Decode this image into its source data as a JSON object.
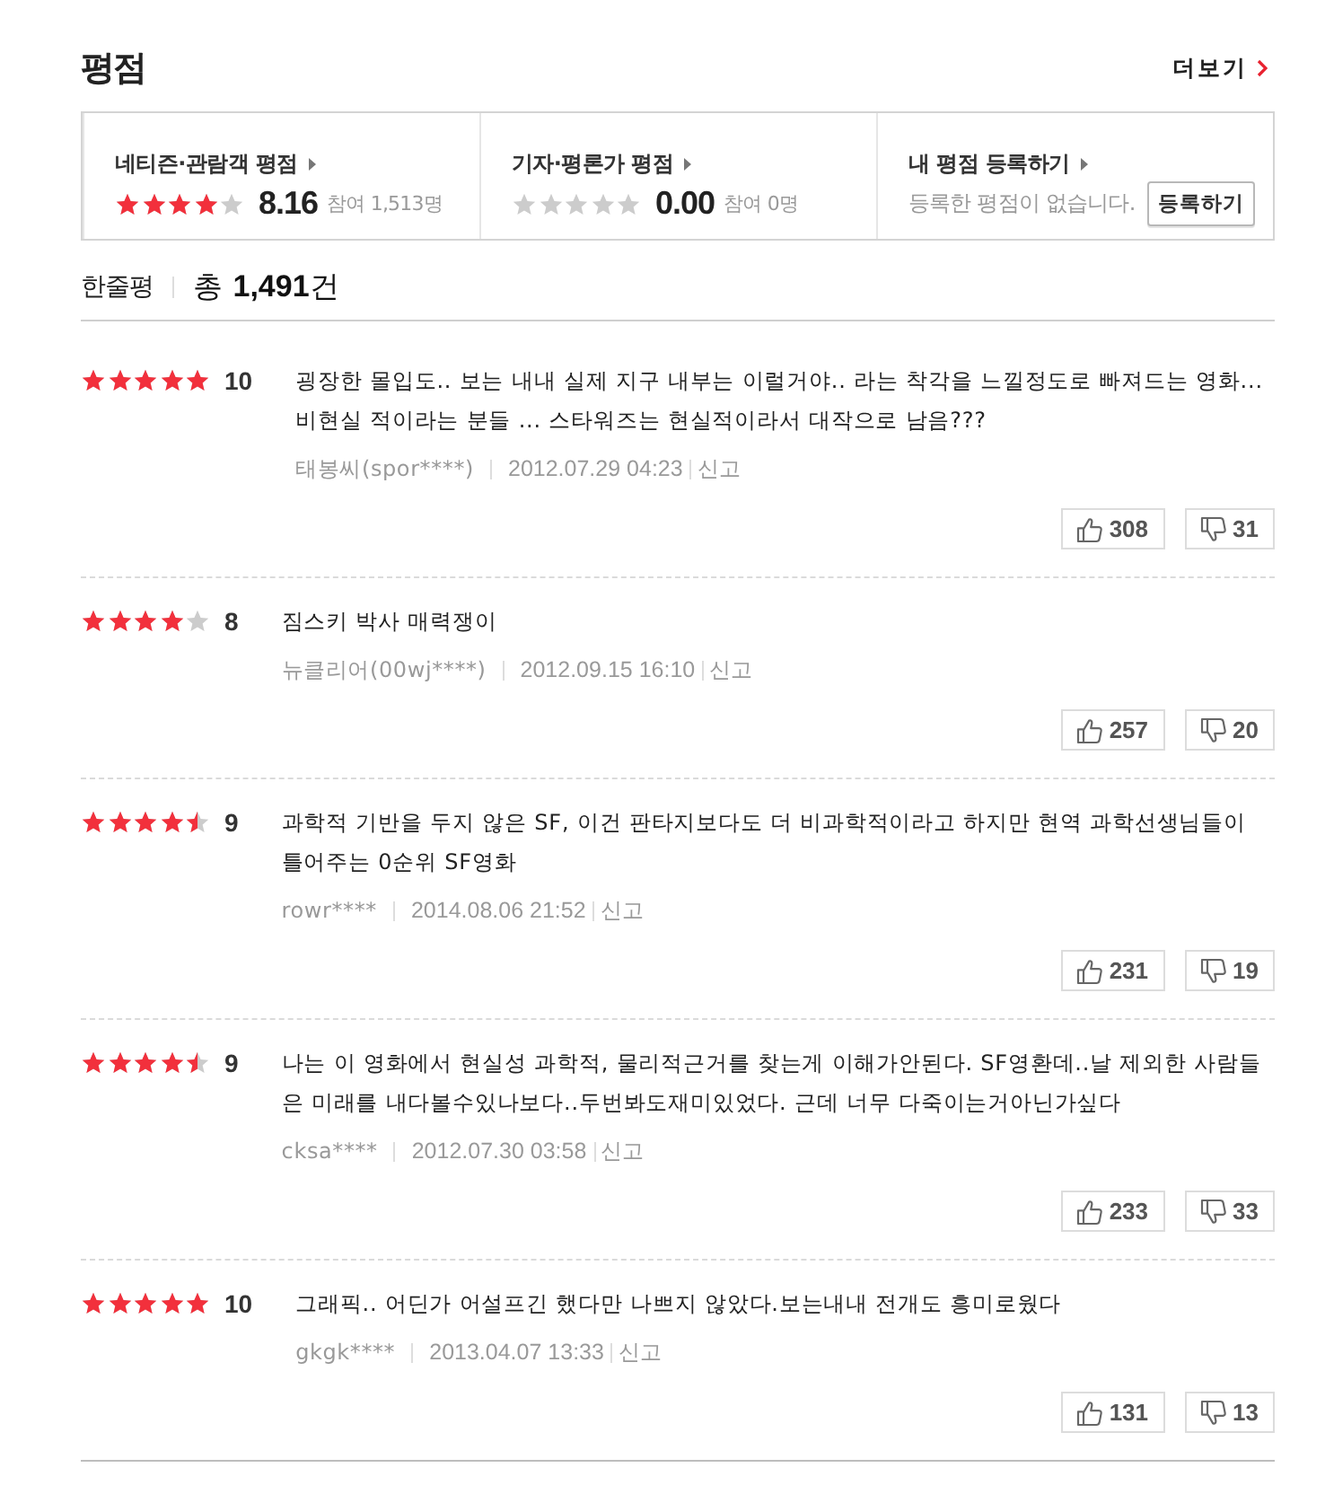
{
  "header": {
    "title": "평점",
    "more_link": "더보기"
  },
  "rating_summary": [
    {
      "kind": "score",
      "label": "네티즌·관람객 평점",
      "stars": 4,
      "score": "8.16",
      "participants": "참여 1,513명"
    },
    {
      "kind": "score",
      "label": "기자·평론가 평점",
      "stars": 0,
      "score": "0.00",
      "participants": "참여 0명"
    },
    {
      "kind": "register",
      "label": "내 평점 등록하기",
      "message": "등록한 평점이 없습니다.",
      "button": "등록하기"
    }
  ],
  "review_list": {
    "title": "한줄평",
    "total": "총 **1,491**건"
  },
  "reviews": [
    {
      "stars": 5,
      "score": "10",
      "text": "굉장한 몰입도.. 보는 내내 실제 지구 내부는 이럴거야.. 라는 착각을 느낄정도로 빠져드는 영화... 비현실 적이라는 분들 ... 스타워즈는 현실적이라서 대작으로 남음???",
      "author": "태봉씨(spor****)",
      "date": "2012.07.29 04:23",
      "report": "신고",
      "likes": "308",
      "dislikes": "31"
    },
    {
      "stars": 4,
      "score": "8",
      "text": "짐스키 박사 매력쟁이",
      "author": "뉴클리어(00wj****)",
      "date": "2012.09.15 16:10",
      "report": "신고",
      "likes": "257",
      "dislikes": "20"
    },
    {
      "stars": 4.5,
      "score": "9",
      "text": "과학적 기반을 두지 않은 SF, 이건 판타지보다도 더 비과학적이라고 하지만 현역 과학선생님들이 틀어주는 0순위 SF영화",
      "author": "rowr****",
      "date": "2014.08.06 21:52",
      "report": "신고",
      "likes": "231",
      "dislikes": "19"
    },
    {
      "stars": 4.5,
      "score": "9",
      "text": "나는 이 영화에서 현실성 과학적, 물리적근거를 찾는게 이해가안된다. SF영환데..날 제외한 사람들은 미래를 내다볼수있나보다..두번봐도재미있었다. 근데 너무 다죽이는거아닌가싶다",
      "author": "cksa****",
      "date": "2012.07.30 03:58",
      "report": "신고",
      "likes": "233",
      "dislikes": "33"
    },
    {
      "stars": 5,
      "score": "10",
      "text": "그래픽.. 어딘가 어설프긴 했다만 나쁘지 않았다.보는내내 전개도 흥미로웠다",
      "author": "gkgk****",
      "date": "2013.04.07 13:33",
      "report": "신고",
      "likes": "131",
      "dislikes": "13"
    }
  ]
}
